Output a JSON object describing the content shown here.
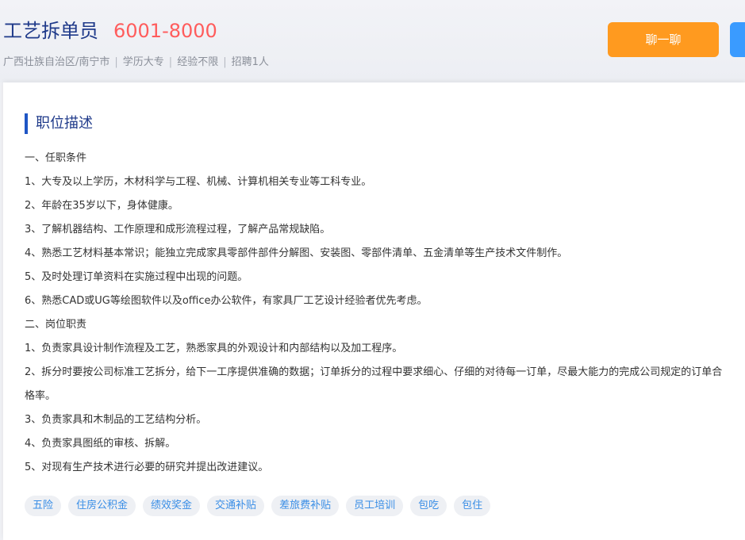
{
  "job": {
    "title": "工艺拆单员",
    "salary": "6001-8000",
    "meta": [
      "广西壮族自治区/南宁市",
      "学历大专",
      "经验不限",
      "招聘1人"
    ]
  },
  "actions": {
    "chat_label": "聊一聊",
    "apply_label": ""
  },
  "description": {
    "heading": "职位描述",
    "lines": [
      "一、任职条件",
      "1、大专及以上学历，木材科学与工程、机械、计算机相关专业等工科专业。",
      "2、年龄在35岁以下，身体健康。",
      "3、了解机器结构、工作原理和成形流程过程，了解产品常规缺陷。",
      "4、熟悉工艺材料基本常识；能独立完成家具零部件部件分解图、安装图、零部件清单、五金清单等生产技术文件制作。",
      "5、及时处理订单资料在实施过程中出现的问题。",
      "6、熟悉CAD或UG等绘图软件以及office办公软件，有家具厂工艺设计经验者优先考虑。",
      "二、岗位职责",
      "1、负责家具设计制作流程及工艺，熟悉家具的外观设计和内部结构以及加工程序。",
      "2、拆分时要按公司标准工艺拆分，给下一工序提供准确的数据；订单拆分的过程中要求细心、仔细的对待每一订单，尽最大能力的完成公司规定的订单合格率。",
      "3、负责家具和木制品的工艺结构分析。",
      "4、负责家具图纸的审核、拆解。",
      "5、对现有生产技术进行必要的研究并提出改进建议。"
    ]
  },
  "benefits": [
    "五险",
    "住房公积金",
    "绩效奖金",
    "交通补贴",
    "差旅费补贴",
    "员工培训",
    "包吃",
    "包住"
  ],
  "colors": {
    "title": "#1f3a8a",
    "salary": "#ff5c5c",
    "chat_button": "#ff9a1f",
    "apply_button": "#3a9bff",
    "tag_text": "#3a8ee6",
    "accent_bar": "#1f56c5"
  }
}
